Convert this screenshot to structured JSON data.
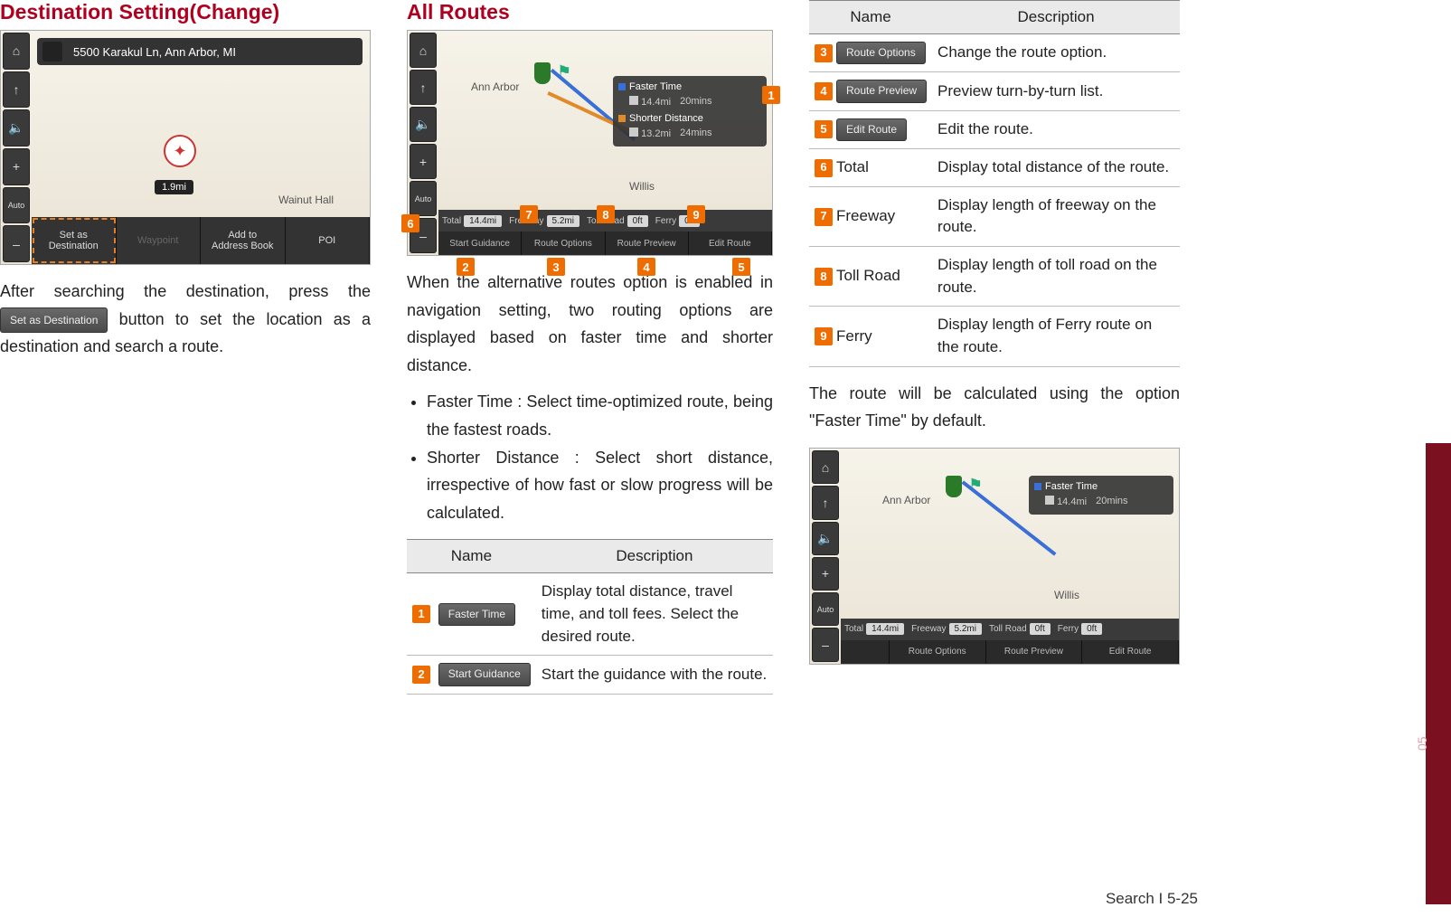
{
  "col1": {
    "heading": "Destination Setting(Change)",
    "screenshot": {
      "address": "5500 Karakul Ln, Ann Arbor, MI",
      "distance": "1.9mi",
      "map_label": "Wainut Hall",
      "buttons": [
        "Set as\nDestination",
        "Waypoint",
        "Add to\nAddress Book",
        "POI"
      ]
    },
    "para_pre": "After searching the destination, press the ",
    "chip": "Set as Destination",
    "para_post": " button to set the location as a destination and search a route."
  },
  "col2": {
    "heading": "All Routes",
    "screenshot": {
      "city": "Ann Arbor",
      "town": "Willis",
      "routes": [
        {
          "name": "Faster Time",
          "dist": "14.4mi",
          "time": "20mins"
        },
        {
          "name": "Shorter Distance",
          "dist": "13.2mi",
          "time": "24mins"
        }
      ],
      "stats": {
        "total_lbl": "Total",
        "total": "14.4mi",
        "freeway_lbl": "Freeway",
        "freeway": "5.2mi",
        "toll_lbl": "Toll Road",
        "toll": "0ft",
        "ferry_lbl": "Ferry",
        "ferry": "0ft"
      },
      "actions": [
        "Start Guidance",
        "Route Options",
        "Route Preview",
        "Edit Route"
      ]
    },
    "callouts": {
      "c1": "1",
      "c2": "2",
      "c3": "3",
      "c4": "4",
      "c5": "5",
      "c6": "6",
      "c7": "7",
      "c8": "8",
      "c9": "9"
    },
    "para1": "When the alternative routes option is enabled in navigation setting, two routing options are displayed based on faster time and shorter distance.",
    "bullets": [
      "Faster Time : Select time-optimized route, being the fastest roads.",
      "Shorter Distance : Select short distance, irrespective of how fast or slow progress will be calculated."
    ],
    "table": {
      "head_name": "Name",
      "head_desc": "Description",
      "rows": [
        {
          "n": "1",
          "chip": "Faster Time",
          "desc": "Display total distance, travel time, and toll fees. Select the desired route."
        },
        {
          "n": "2",
          "chip": "Start Guidance",
          "desc": "Start the guidance with the route."
        }
      ]
    }
  },
  "col3": {
    "table": {
      "head_name": "Name",
      "head_desc": "Description",
      "rows": [
        {
          "n": "3",
          "chip": "Route Options",
          "desc": "Change the route option."
        },
        {
          "n": "4",
          "chip": "Route Preview",
          "desc": "Preview turn-by-turn list."
        },
        {
          "n": "5",
          "chip": "Edit Route",
          "desc": "Edit the route."
        },
        {
          "n": "6",
          "text": "Total",
          "desc": "Display total distance of the route."
        },
        {
          "n": "7",
          "text": "Freeway",
          "desc": "Display length of freeway on the route."
        },
        {
          "n": "8",
          "text": "Toll Road",
          "desc": "Display length of toll road on the route."
        },
        {
          "n": "9",
          "text": "Ferry",
          "desc": "Display length of Ferry route on the route."
        }
      ]
    },
    "para": "The route will be calculated using the option \"Faster Time\" by default.",
    "screenshot": {
      "city": "Ann Arbor",
      "town": "Willis",
      "route": {
        "name": "Faster Time",
        "dist": "14.4mi",
        "time": "20mins"
      },
      "stats": {
        "total_lbl": "Total",
        "total": "14.4mi",
        "freeway_lbl": "Freeway",
        "freeway": "5.2mi",
        "toll_lbl": "Toll Road",
        "toll": "0ft",
        "ferry_lbl": "Ferry",
        "ferry": "0ft"
      },
      "actions": [
        "Route Options",
        "Route Preview",
        "Edit Route"
      ]
    }
  },
  "sidebar_num": "05",
  "footer": "Search I 5-25"
}
